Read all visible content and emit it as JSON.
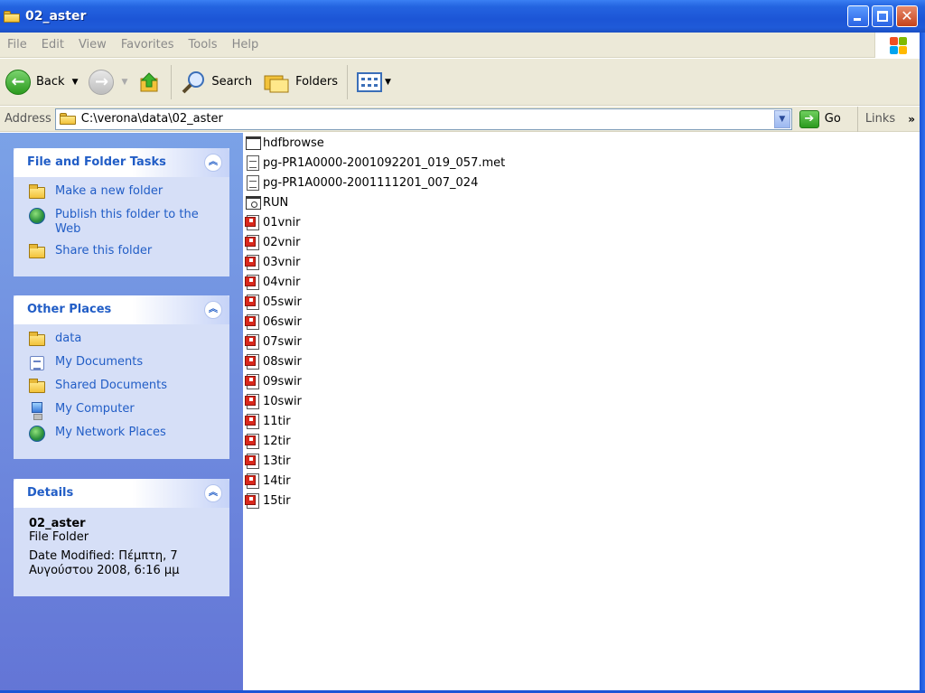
{
  "window": {
    "title": "02_aster"
  },
  "menu": [
    "File",
    "Edit",
    "View",
    "Favorites",
    "Tools",
    "Help"
  ],
  "toolbar": {
    "back_label": "Back",
    "search_label": "Search",
    "folders_label": "Folders"
  },
  "address": {
    "label": "Address",
    "value": "C:\\verona\\data\\02_aster",
    "go_label": "Go",
    "links_label": "Links",
    "chevron": "»"
  },
  "tasks": {
    "file_folder": {
      "title": "File and Folder Tasks",
      "items": [
        "Make a new folder",
        "Publish this folder to the Web",
        "Share this folder"
      ]
    },
    "other_places": {
      "title": "Other Places",
      "items": [
        "data",
        "My Documents",
        "Shared Documents",
        "My Computer",
        "My Network Places"
      ]
    },
    "details": {
      "title": "Details",
      "name": "02_aster",
      "type": "File Folder",
      "date": "Date Modified: Πέμπτη, 7 Αυγούστου 2008, 6:16 μμ"
    }
  },
  "files": [
    {
      "name": "hdfbrowse",
      "icon": "blank-window-icon"
    },
    {
      "name": "pg-PR1A0000-2001092201_019_057.met",
      "icon": "document-icon"
    },
    {
      "name": "pg-PR1A0000-2001111201_007_024",
      "icon": "document-icon"
    },
    {
      "name": "RUN",
      "icon": "program-icon"
    },
    {
      "name": "01vnir",
      "icon": "image-file-icon"
    },
    {
      "name": "02vnir",
      "icon": "image-file-icon"
    },
    {
      "name": "03vnir",
      "icon": "image-file-icon"
    },
    {
      "name": "04vnir",
      "icon": "image-file-icon"
    },
    {
      "name": "05swir",
      "icon": "image-file-icon"
    },
    {
      "name": "06swir",
      "icon": "image-file-icon"
    },
    {
      "name": "07swir",
      "icon": "image-file-icon"
    },
    {
      "name": "08swir",
      "icon": "image-file-icon"
    },
    {
      "name": "09swir",
      "icon": "image-file-icon"
    },
    {
      "name": "10swir",
      "icon": "image-file-icon"
    },
    {
      "name": "11tir",
      "icon": "image-file-icon"
    },
    {
      "name": "12tir",
      "icon": "image-file-icon"
    },
    {
      "name": "13tir",
      "icon": "image-file-icon"
    },
    {
      "name": "14tir",
      "icon": "image-file-icon"
    },
    {
      "name": "15tir",
      "icon": "image-file-icon"
    }
  ]
}
